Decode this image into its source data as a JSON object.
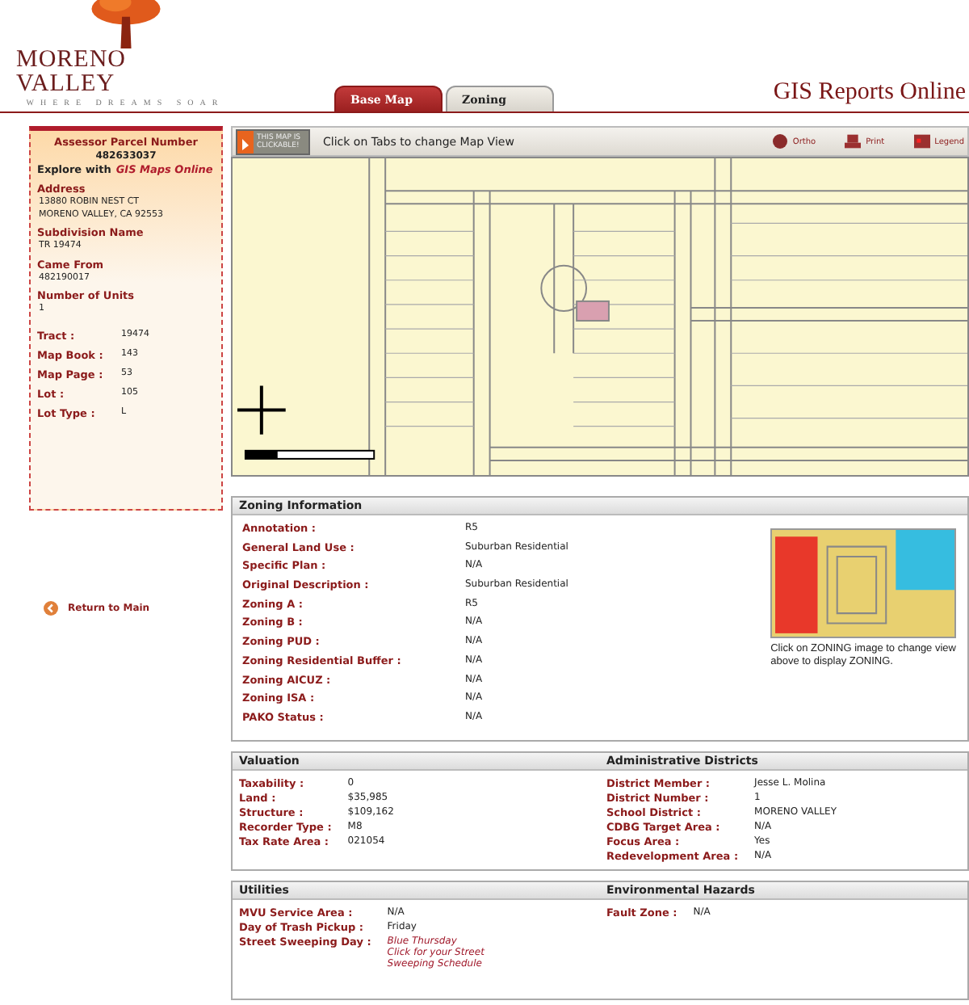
{
  "header": {
    "logo_name": "MORENO VALLEY",
    "tagline": "WHERE DREAMS SOAR",
    "title": "GIS Reports Online"
  },
  "tabs": [
    {
      "label": "Base Map",
      "selected": true
    },
    {
      "label": "Zoning",
      "selected": false
    }
  ],
  "sidebar": {
    "heading": "Assessor Parcel Number",
    "parcel": "482633037",
    "explore_prefix": "Explore with",
    "explore_link": "GIS Maps Online",
    "sections": [
      {
        "label": "Address",
        "lines": [
          "13880 ROBIN NEST CT",
          "MORENO VALLEY, CA 92553"
        ]
      },
      {
        "label": "Subdivision Name",
        "lines": [
          "TR 19474"
        ]
      },
      {
        "label": "Came From",
        "lines": [
          "482190017"
        ]
      },
      {
        "label": "Number of Units",
        "lines": [
          "1"
        ]
      }
    ],
    "fields": [
      {
        "label": "Tract :",
        "value": "19474"
      },
      {
        "label": "Map Book :",
        "value": "143"
      },
      {
        "label": "Map Page :",
        "value": "53"
      },
      {
        "label": "Lot :",
        "value": "105"
      },
      {
        "label": "Lot Type :",
        "value": "L"
      }
    ]
  },
  "return_link": "Return to Main",
  "map_toolbar": {
    "badge": "THIS MAP IS CLICKABLE!",
    "hint": "Click on Tabs to change Map View",
    "tools": [
      {
        "kind": "ortho",
        "label": "Ortho"
      },
      {
        "kind": "print",
        "label": "Print"
      },
      {
        "kind": "legend",
        "label": "Legend"
      }
    ]
  },
  "zoning": {
    "title": "Zoning Information",
    "caption": "Click on ZONING image to change view above to display ZONING.",
    "rows": [
      {
        "label": "Annotation :",
        "value": "R5"
      },
      {
        "label": "General Land Use :",
        "value": "Suburban Residential"
      },
      {
        "label": "Specific Plan :",
        "value": "N/A"
      },
      {
        "label": "Original Description :",
        "value": "Suburban Residential"
      },
      {
        "label": "Zoning A :",
        "value": "R5"
      },
      {
        "label": "Zoning B :",
        "value": "N/A"
      },
      {
        "label": "Zoning PUD :",
        "value": "N/A"
      },
      {
        "label": "Zoning Residential Buffer :",
        "value": "N/A"
      },
      {
        "label": "Zoning AICUZ :",
        "value": "N/A"
      },
      {
        "label": "Zoning ISA :",
        "value": "N/A"
      },
      {
        "label": "PAKO Status :",
        "value": "N/A"
      }
    ]
  },
  "panels": [
    {
      "sections": [
        {
          "title": "Valuation",
          "rows": [
            {
              "kind": "plain",
              "label": "Taxability :",
              "value": "0"
            },
            {
              "kind": "plain",
              "label": "Land :",
              "value": "$35,985"
            },
            {
              "kind": "plain",
              "label": "Structure :",
              "value": "$109,162"
            },
            {
              "kind": "plain",
              "label": "Recorder Type :",
              "value": "M8"
            },
            {
              "kind": "plain",
              "label": "Tax Rate Area :",
              "value": "021054"
            }
          ]
        },
        {
          "title": "Administrative Districts",
          "rows": [
            {
              "kind": "plain",
              "label": "District Member :",
              "value": "Jesse L. Molina"
            },
            {
              "kind": "plain",
              "label": "District Number :",
              "value": "1"
            },
            {
              "kind": "plain",
              "label": "School District :",
              "value": "MORENO VALLEY"
            },
            {
              "kind": "plain",
              "label": "CDBG Target Area :",
              "value": "N/A"
            },
            {
              "kind": "plain",
              "label": "Focus Area :",
              "value": "Yes"
            },
            {
              "kind": "plain",
              "label": "Redevelopment Area :",
              "value": "N/A"
            }
          ]
        }
      ]
    },
    {
      "sections": [
        {
          "title": "Utilities",
          "rows": [
            {
              "kind": "plain",
              "label": "MVU Service Area :",
              "value": "N/A"
            },
            {
              "kind": "plain",
              "label": "Day of Trash Pickup :",
              "value": "Friday"
            },
            {
              "kind": "highlight",
              "label": "Street Sweeping Day :",
              "value": "Blue Thursday",
              "link": "Click for your Street Sweeping Schedule"
            }
          ]
        },
        {
          "title": "Environmental Hazards",
          "rows": [
            {
              "kind": "plain",
              "label": "Fault Zone :",
              "value": "N/A"
            }
          ]
        }
      ]
    }
  ]
}
